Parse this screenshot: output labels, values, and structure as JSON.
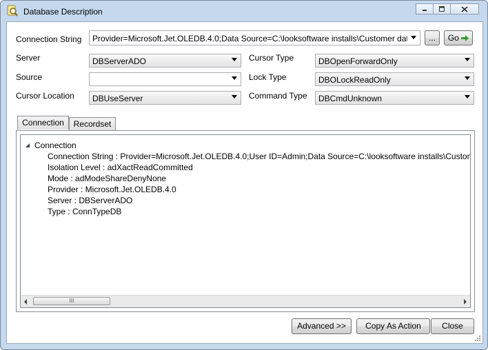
{
  "window": {
    "title": "Database Description",
    "controls": {
      "minimize": "minimize-icon",
      "maximize": "maximize-icon",
      "close": "close-icon"
    }
  },
  "connection_string": {
    "label": "Connection String",
    "value": "Provider=Microsoft.Jet.OLEDB.4.0;Data Source=C:\\looksoftware installs\\Customer data",
    "browse_label": "...",
    "go_label": "Go"
  },
  "fields": {
    "server": {
      "label": "Server",
      "value": "DBServerADO"
    },
    "source": {
      "label": "Source",
      "value": ""
    },
    "cursor_location": {
      "label": "Cursor Location",
      "value": "DBUseServer"
    },
    "cursor_type": {
      "label": "Cursor Type",
      "value": "DBOpenForwardOnly"
    },
    "lock_type": {
      "label": "Lock Type",
      "value": "DBOLockReadOnly"
    },
    "command_type": {
      "label": "Command Type",
      "value": "DBCmdUnknown"
    }
  },
  "tabs": [
    {
      "label": "Connection",
      "active": true
    },
    {
      "label": "Recordset",
      "active": false
    }
  ],
  "tree": {
    "root": "Connection",
    "children": [
      "Connection String : Provider=Microsoft.Jet.OLEDB.4.0;User ID=Admin;Data Source=C:\\looksoftware installs\\Customer",
      "Isolation Level : adXactReadCommitted",
      "Mode : adModeShareDenyNone",
      "Provider : Microsoft.Jet.OLEDB.4.0",
      "Server : DBServerADO",
      "Type : ConnTypeDB"
    ],
    "scroll_grip": "III"
  },
  "buttons": {
    "advanced": "Advanced >>",
    "copy_as_action": "Copy As Action",
    "close": "Close"
  },
  "colors": {
    "title_bg": "#c5d8ee",
    "go_arrow": "#2e9a2e"
  }
}
